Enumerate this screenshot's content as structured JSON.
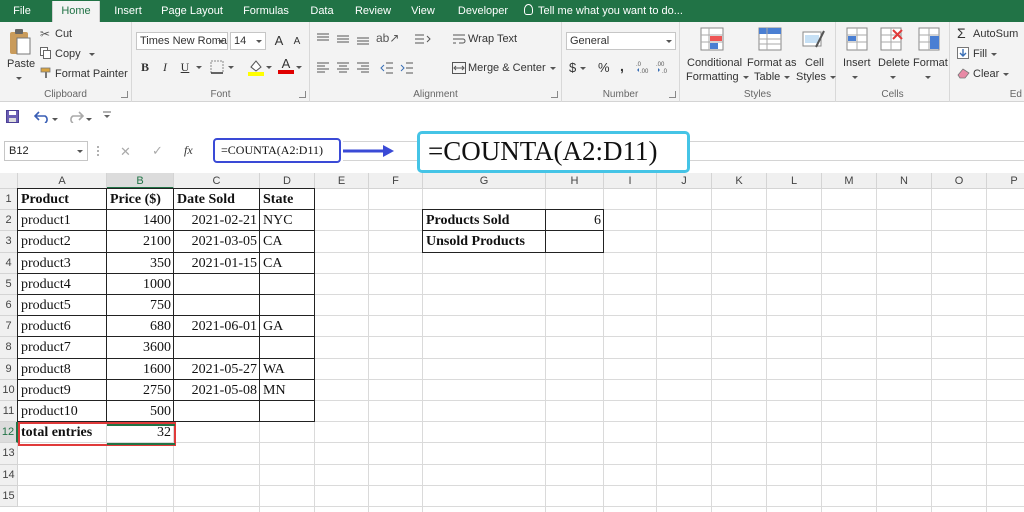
{
  "ribbon_tabs": [
    "File",
    "Home",
    "Insert",
    "Page Layout",
    "Formulas",
    "Data",
    "Review",
    "View",
    "Developer"
  ],
  "tell_me": "Tell me what you want to do...",
  "clipboard": {
    "paste": "Paste",
    "cut": "Cut",
    "copy": "Copy",
    "format_painter": "Format Painter",
    "label": "Clipboard"
  },
  "font": {
    "name": "Times New Roma",
    "size": "14",
    "bold": "B",
    "italic": "I",
    "underline": "U",
    "grow": "A",
    "shrink": "A",
    "font_color_glyph": "A",
    "label": "Font",
    "fill_color": "#ffff00",
    "font_color": "#e00000"
  },
  "alignment": {
    "wrap_text": "Wrap Text",
    "merge_center": "Merge & Center",
    "label": "Alignment"
  },
  "number": {
    "format": "General",
    "currency": "$",
    "percent": "%",
    "comma": ",",
    "label": "Number"
  },
  "styles": {
    "conditional": [
      "Conditional",
      "Formatting"
    ],
    "format_as": [
      "Format as",
      "Table"
    ],
    "cell": [
      "Cell",
      "Styles"
    ],
    "label": "Styles"
  },
  "cells": {
    "insert": "Insert",
    "delete": "Delete",
    "format": "Format",
    "label": "Cells"
  },
  "editing": {
    "autosum": "AutoSum",
    "fill": "Fill",
    "clear": "Clear",
    "label": "Ed"
  },
  "formula_bar": {
    "name_box": "B12",
    "fx": "fx",
    "formula": "=COUNTA(A2:D11)",
    "callout": "=COUNTA(A2:D11)"
  },
  "columns": [
    "A",
    "B",
    "C",
    "D",
    "E",
    "F",
    "G",
    "H",
    "I",
    "J",
    "K",
    "L",
    "M",
    "N",
    "O",
    "P"
  ],
  "rows": [
    "1",
    "2",
    "3",
    "4",
    "5",
    "6",
    "7",
    "8",
    "9",
    "10",
    "11",
    "12",
    "13",
    "14",
    "15"
  ],
  "table": {
    "headers": [
      "Product",
      "Price ($)",
      "Date Sold",
      "State"
    ],
    "rows": [
      [
        "product1",
        "1400",
        "2021-02-21",
        "NYC"
      ],
      [
        "product2",
        "2100",
        "2021-03-05",
        "CA"
      ],
      [
        "product3",
        "350",
        "2021-01-15",
        "CA"
      ],
      [
        "product4",
        "1000",
        "",
        ""
      ],
      [
        "product5",
        "750",
        "",
        ""
      ],
      [
        "product6",
        "680",
        "2021-06-01",
        "GA"
      ],
      [
        "product7",
        "3600",
        "",
        ""
      ],
      [
        "product8",
        "1600",
        "2021-05-27",
        "WA"
      ],
      [
        "product9",
        "2750",
        "2021-05-08",
        "MN"
      ],
      [
        "product10",
        "500",
        "",
        ""
      ]
    ],
    "total_label": "total entries",
    "total_value": "32"
  },
  "summary": {
    "rows": [
      {
        "label": "Products Sold",
        "value": "6"
      },
      {
        "label": "Unsold Products",
        "value": ""
      }
    ]
  },
  "colors": {
    "excel_green": "#217346",
    "highlight_red": "#e03a3a",
    "formula_box": "#3a4ad6",
    "callout_border": "#45c4e6"
  }
}
